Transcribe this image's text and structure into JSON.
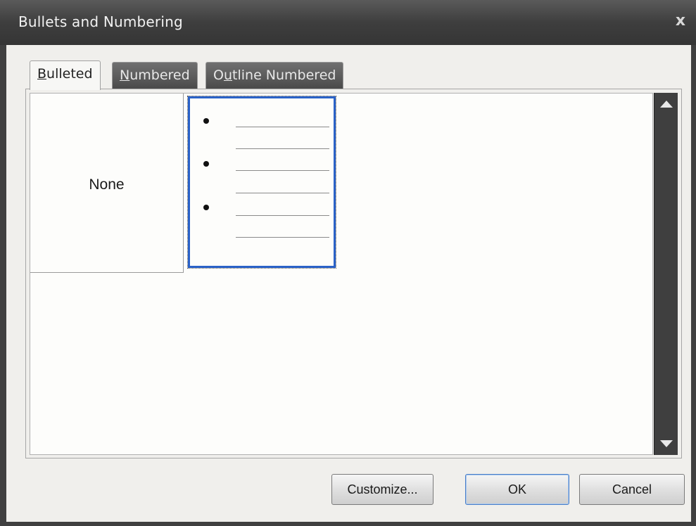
{
  "window": {
    "title": "Bullets and Numbering",
    "close_glyph": "x"
  },
  "tabs": [
    {
      "label_accel": "B",
      "label_rest": "ulleted",
      "active": true
    },
    {
      "label_accel": "N",
      "label_rest": "umbered",
      "active": false
    },
    {
      "label_pre": "O",
      "label_accel": "u",
      "label_rest": "tline Numbered",
      "active": false
    }
  ],
  "gallery": {
    "none_label": "None",
    "selected_style": "bullet-disc",
    "icons": {
      "scroll_up": "triangle-up",
      "scroll_down": "triangle-down"
    }
  },
  "buttons": {
    "customize": "Customize...",
    "ok": "OK",
    "cancel": "Cancel"
  },
  "colors": {
    "selection_border": "#2a62c8",
    "title_bar": "#404040",
    "dialog_bg": "#f0efec"
  }
}
